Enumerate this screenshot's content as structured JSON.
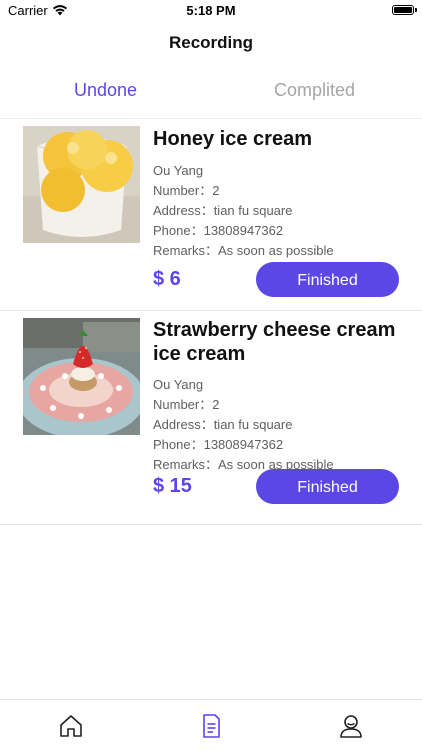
{
  "status_bar": {
    "carrier": "Carrier",
    "time": "5:18 PM",
    "wifi_icon": "wifi-icon",
    "battery_icon": "battery-icon"
  },
  "nav": {
    "title": "Recording"
  },
  "tabs": [
    {
      "label": "Undone",
      "active": true
    },
    {
      "label": "Complited",
      "active": false
    }
  ],
  "orders": [
    {
      "title": "Honey ice cream",
      "name": "Ou Yang",
      "number": "Number：2",
      "address": "Address：tian fu square",
      "phone": "Phone：13808947362",
      "remarks": "Remarks：As soon as possible",
      "price": "$ 6",
      "button_label": "Finished",
      "image_icon": "honey-ice-cream-photo"
    },
    {
      "title": "Strawberry cheese cream ice cream",
      "name": "Ou Yang",
      "number": "Number：2",
      "address": "Address：tian fu square",
      "phone": "Phone：13808947362",
      "remarks": "Remarks：As soon as possible",
      "price": "$ 15",
      "button_label": "Finished",
      "image_icon": "strawberry-cake-photo"
    }
  ],
  "tabbar": [
    {
      "icon": "home-icon",
      "active": false
    },
    {
      "icon": "document-icon",
      "active": true
    },
    {
      "icon": "user-icon",
      "active": false
    }
  ],
  "colors": {
    "accent": "#5b46e6",
    "inactive_tab": "#a6a6a6",
    "detail_text": "#606060"
  }
}
